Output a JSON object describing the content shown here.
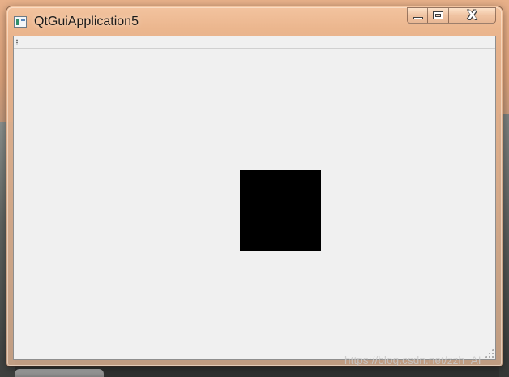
{
  "window": {
    "title": "QtGuiApplication5",
    "controls": {
      "minimize": "minimize",
      "maximize": "maximize",
      "close": "X"
    }
  },
  "toolbar": {
    "handle": "toolbar-grip"
  },
  "canvas": {
    "background_color": "#f0f0f0",
    "shape": {
      "kind": "filled-rectangle",
      "color": "#000000"
    }
  },
  "desktop": {
    "watermark": "https://blog.csdn.net/zzh_AI"
  }
}
